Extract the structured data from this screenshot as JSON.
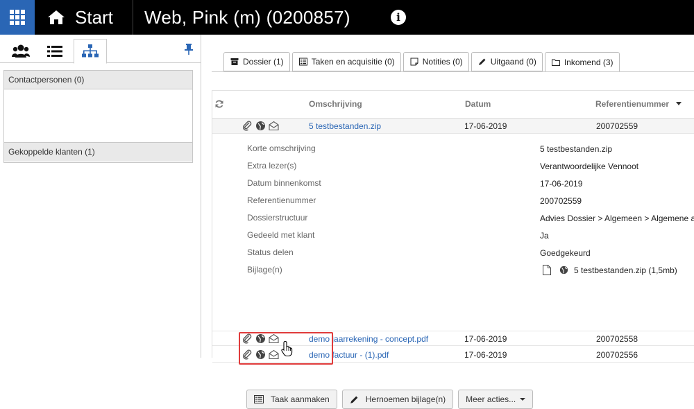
{
  "topbar": {
    "start_label": "Start",
    "client_title": "Web, Pink (m) (0200857)",
    "info_glyph": "i"
  },
  "sidebar": {
    "tabs": [
      {
        "icon": "group-icon"
      },
      {
        "icon": "list-icon"
      },
      {
        "icon": "hierarchy-icon",
        "active": true
      }
    ],
    "panels": [
      {
        "label": "Contactpersonen (0)"
      },
      {
        "label": "Gekoppelde klanten (1)"
      }
    ]
  },
  "tabs": [
    {
      "label": "Dossier (1)",
      "icon": "archive-icon"
    },
    {
      "label": "Taken en acquisitie (0)",
      "icon": "tasks-icon"
    },
    {
      "label": "Notities (0)",
      "icon": "note-icon"
    },
    {
      "label": "Uitgaand (0)",
      "icon": "pencil-icon"
    },
    {
      "label": "Inkomend (3)",
      "icon": "folder-icon",
      "active": true
    }
  ],
  "grid": {
    "columns": {
      "omschrijving": "Omschrijving",
      "datum": "Datum",
      "referentienummer": "Referentienummer"
    },
    "rows": [
      {
        "name": "5 testbestanden.zip",
        "date": "17-06-2019",
        "ref": "200702559"
      },
      {
        "name": "demo jaarrekening - concept.pdf",
        "date": "17-06-2019",
        "ref": "200702558"
      },
      {
        "name": "demo factuur - (1).pdf",
        "date": "17-06-2019",
        "ref": "200702556"
      }
    ],
    "details": [
      {
        "label": "Korte omschrijving",
        "value": "5 testbestanden.zip"
      },
      {
        "label": "Extra lezer(s)",
        "value": "Verantwoordelijke Vennoot"
      },
      {
        "label": "Datum binnenkomst",
        "value": "17-06-2019"
      },
      {
        "label": "Referentienummer",
        "value": "200702559"
      },
      {
        "label": "Dossierstructuur",
        "value": "Advies Dossier > Algemeen > Algemene a"
      },
      {
        "label": "Gedeeld met klant",
        "value": "Ja"
      },
      {
        "label": "Status delen",
        "value": "Goedgekeurd"
      },
      {
        "label": "Bijlage(n)",
        "value": "5 testbestanden.zip (1,5mb)"
      }
    ],
    "actions": {
      "create_task": "Taak aanmaken",
      "rename_attachment": "Hernoemen bijlage(n)",
      "more_actions": "Meer acties..."
    }
  },
  "colors": {
    "accent": "#2a66b5",
    "topbar": "#000000",
    "highlight": "#e03b3b"
  }
}
